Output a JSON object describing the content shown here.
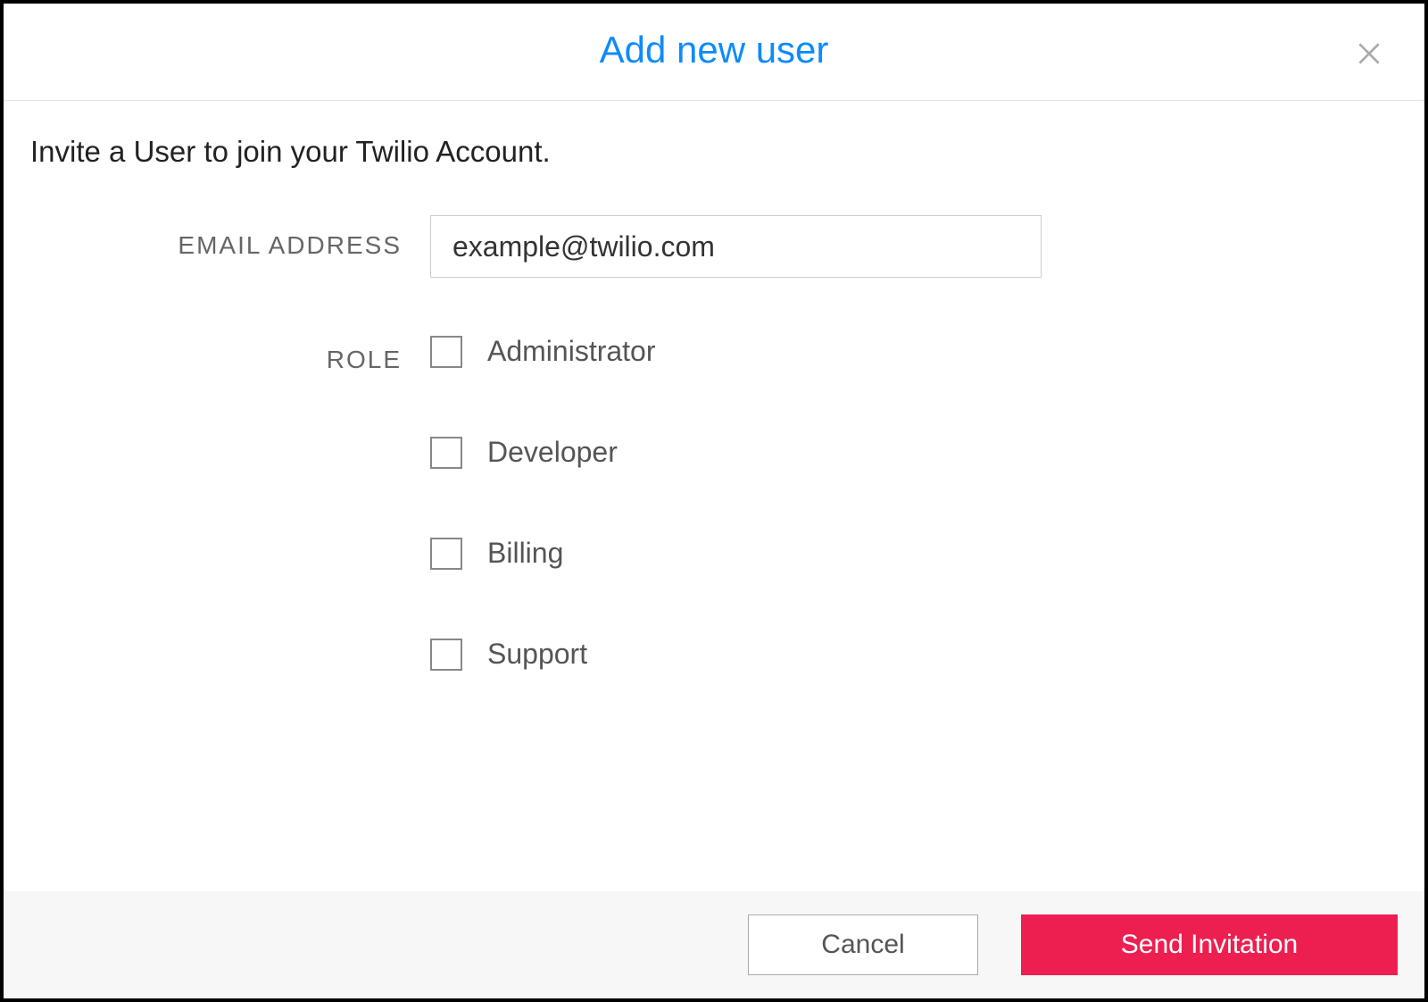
{
  "modal": {
    "title": "Add new user",
    "subtitle": "Invite a User to join your Twilio Account.",
    "form": {
      "email_label": "EMAIL ADDRESS",
      "email_value": "example@twilio.com",
      "role_label": "ROLE",
      "roles": [
        {
          "label": "Administrator",
          "checked": false
        },
        {
          "label": "Developer",
          "checked": false
        },
        {
          "label": "Billing",
          "checked": false
        },
        {
          "label": "Support",
          "checked": false
        }
      ]
    },
    "buttons": {
      "cancel": "Cancel",
      "submit": "Send Invitation"
    }
  }
}
